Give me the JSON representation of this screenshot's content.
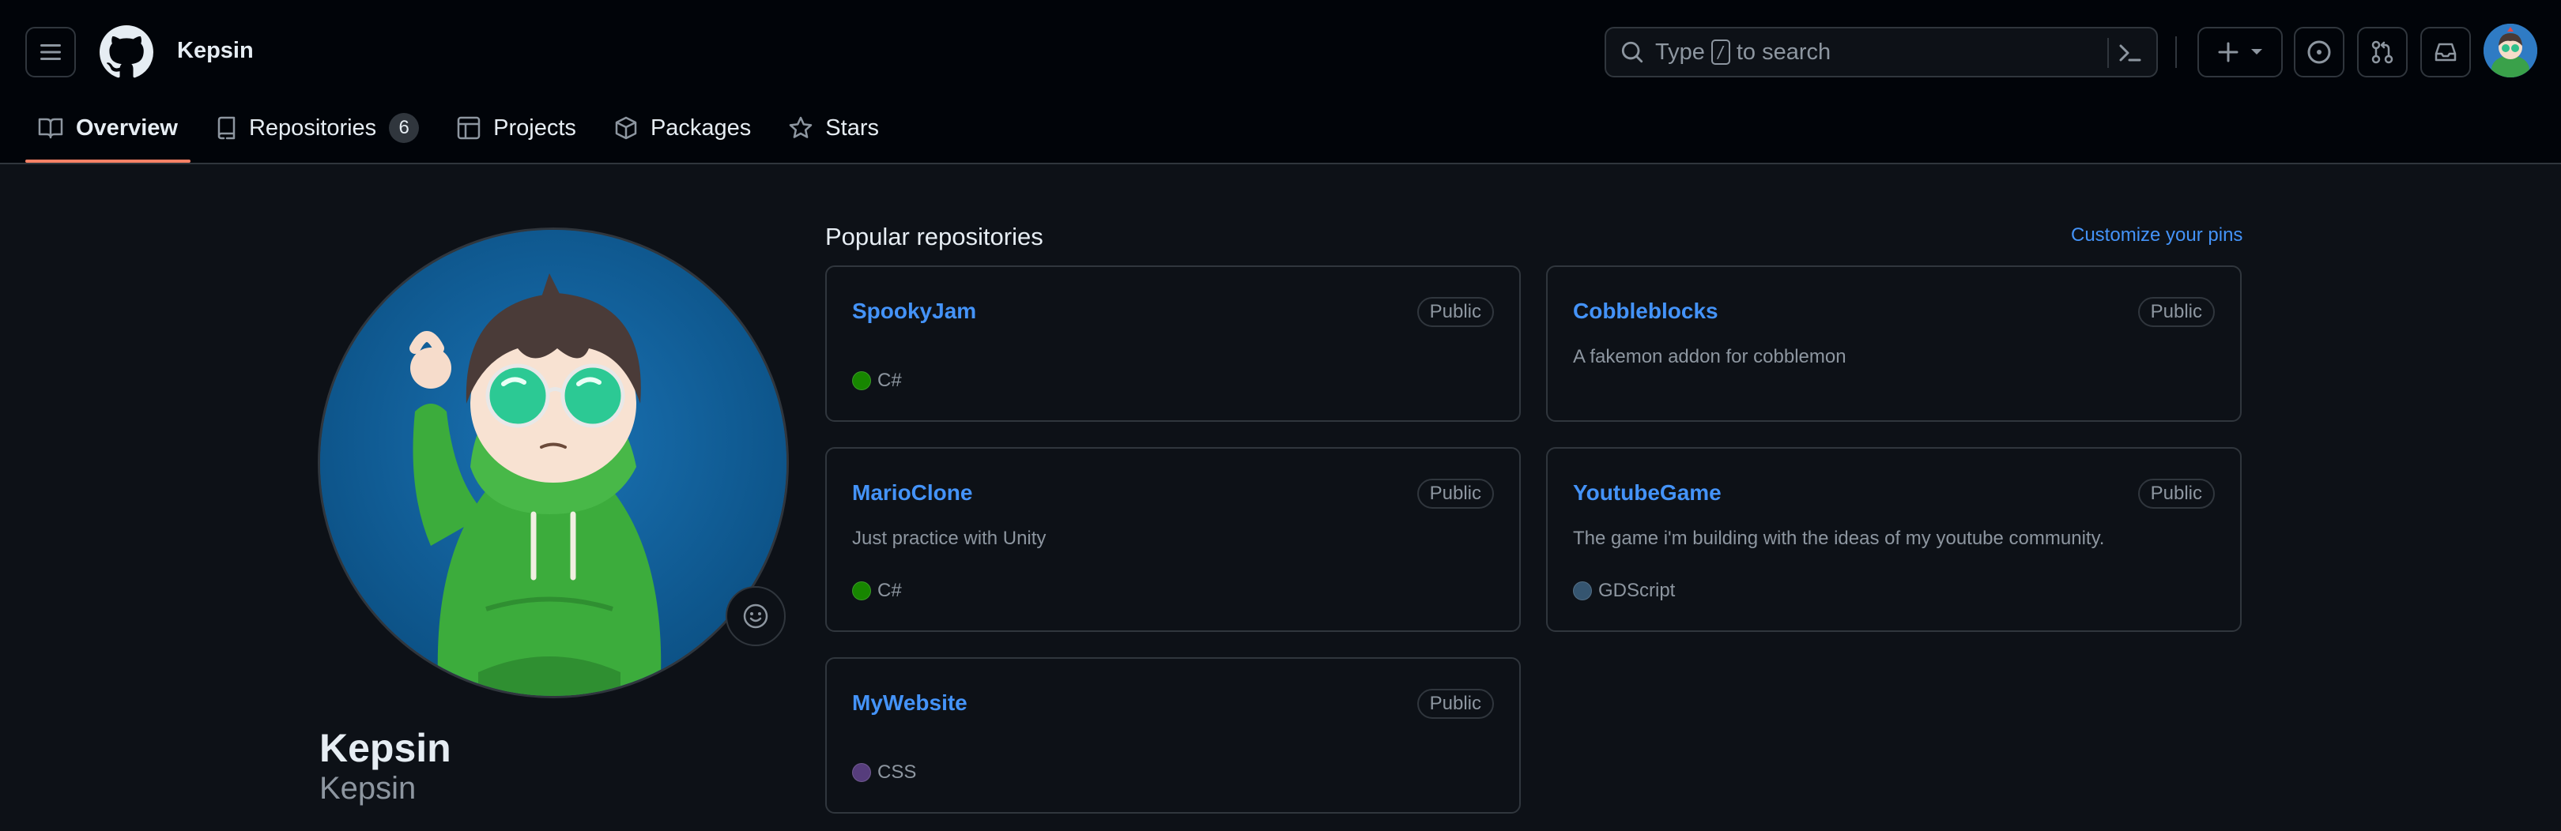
{
  "header": {
    "username": "Kepsin",
    "search": {
      "prefix": "Type",
      "key": "/",
      "suffix": "to search"
    }
  },
  "tabs": [
    {
      "label": "Overview",
      "icon": "book-icon",
      "active": true
    },
    {
      "label": "Repositories",
      "icon": "repo-icon",
      "count": "6"
    },
    {
      "label": "Projects",
      "icon": "table-icon"
    },
    {
      "label": "Packages",
      "icon": "package-icon"
    },
    {
      "label": "Stars",
      "icon": "star-icon"
    }
  ],
  "profile": {
    "name": "Kepsin",
    "login": "Kepsin"
  },
  "popular": {
    "title": "Popular repositories",
    "customize_label": "Customize your pins",
    "repos": [
      {
        "name": "SpookyJam",
        "visibility": "Public",
        "description": "",
        "language": "C#",
        "language_color": "#178600"
      },
      {
        "name": "Cobbleblocks",
        "visibility": "Public",
        "description": "A fakemon addon for cobblemon",
        "language": "",
        "language_color": ""
      },
      {
        "name": "MarioClone",
        "visibility": "Public",
        "description": "Just practice with Unity",
        "language": "C#",
        "language_color": "#178600"
      },
      {
        "name": "YoutubeGame",
        "visibility": "Public",
        "description": "The game i'm building with the ideas of my youtube community.",
        "language": "GDScript",
        "language_color": "#355570"
      },
      {
        "name": "MyWebsite",
        "visibility": "Public",
        "description": "",
        "language": "CSS",
        "language_color": "#563d7c"
      }
    ]
  },
  "colors": {
    "background": "#0d1117",
    "header": "#010409",
    "border": "#30363d",
    "link": "#4493f8",
    "muted": "#8d96a0",
    "tab_underline": "#f78166"
  }
}
